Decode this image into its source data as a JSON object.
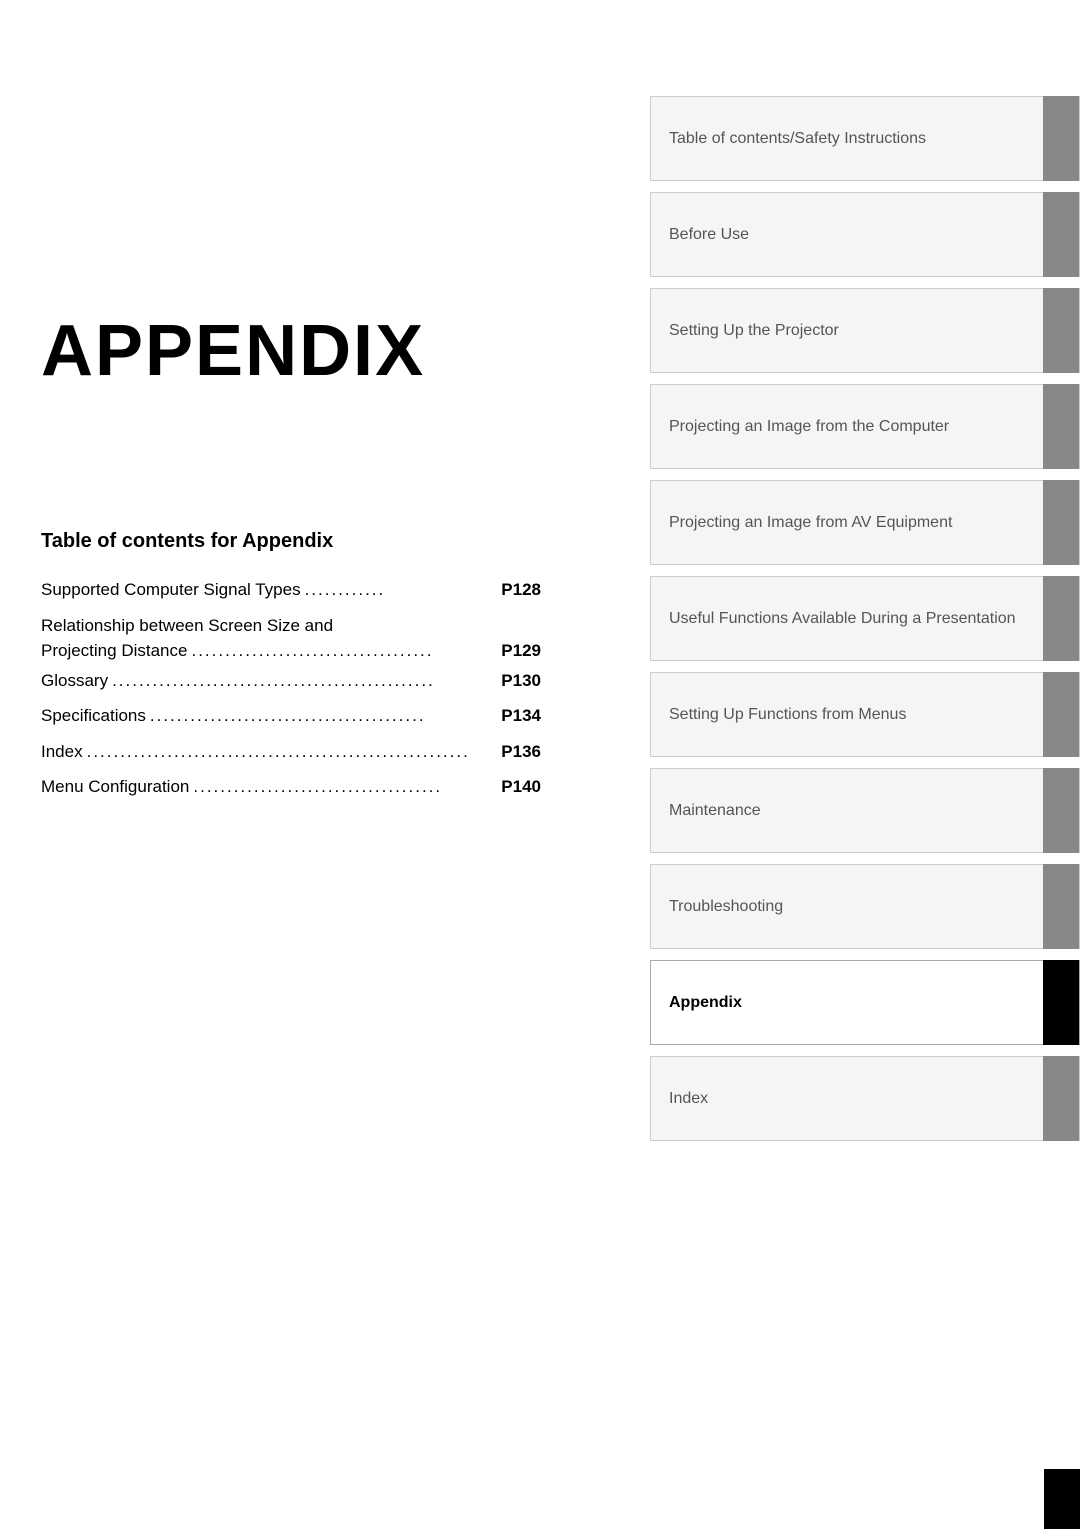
{
  "chapter": {
    "title": "APPENDIX"
  },
  "toc": {
    "heading": "Table of contents for Appendix",
    "entries": [
      {
        "text": "Supported Computer Signal Types",
        "dots": "............",
        "page": "P128"
      },
      {
        "text": "Relationship between Screen Size and\nProjecting Distance",
        "dots": ".....................................",
        "page": "P129"
      },
      {
        "text": "Glossary ",
        "dots": "................................................",
        "page": "P130"
      },
      {
        "text": "Specifications ",
        "dots": ".......................................",
        "page": "P134"
      },
      {
        "text": "Index",
        "dots": ".......................................................",
        "page": "P136"
      },
      {
        "text": "Menu Configuration ",
        "dots": "...................................",
        "page": "P140"
      }
    ]
  },
  "nav": {
    "items": [
      {
        "label": "Table of contents/Safety Instructions",
        "active": false
      },
      {
        "label": "Before Use",
        "active": false
      },
      {
        "label": "Setting Up the Projector",
        "active": false
      },
      {
        "label": "Projecting an Image from the Computer",
        "active": false
      },
      {
        "label": "Projecting an Image from AV Equipment",
        "active": false
      },
      {
        "label": "Useful Functions Available During a Presentation",
        "active": false
      },
      {
        "label": "Setting Up Functions from Menus",
        "active": false
      },
      {
        "label": "Maintenance",
        "active": false
      },
      {
        "label": "Troubleshooting",
        "active": false
      },
      {
        "label": "Appendix",
        "active": true
      },
      {
        "label": "Index",
        "active": false
      }
    ]
  }
}
